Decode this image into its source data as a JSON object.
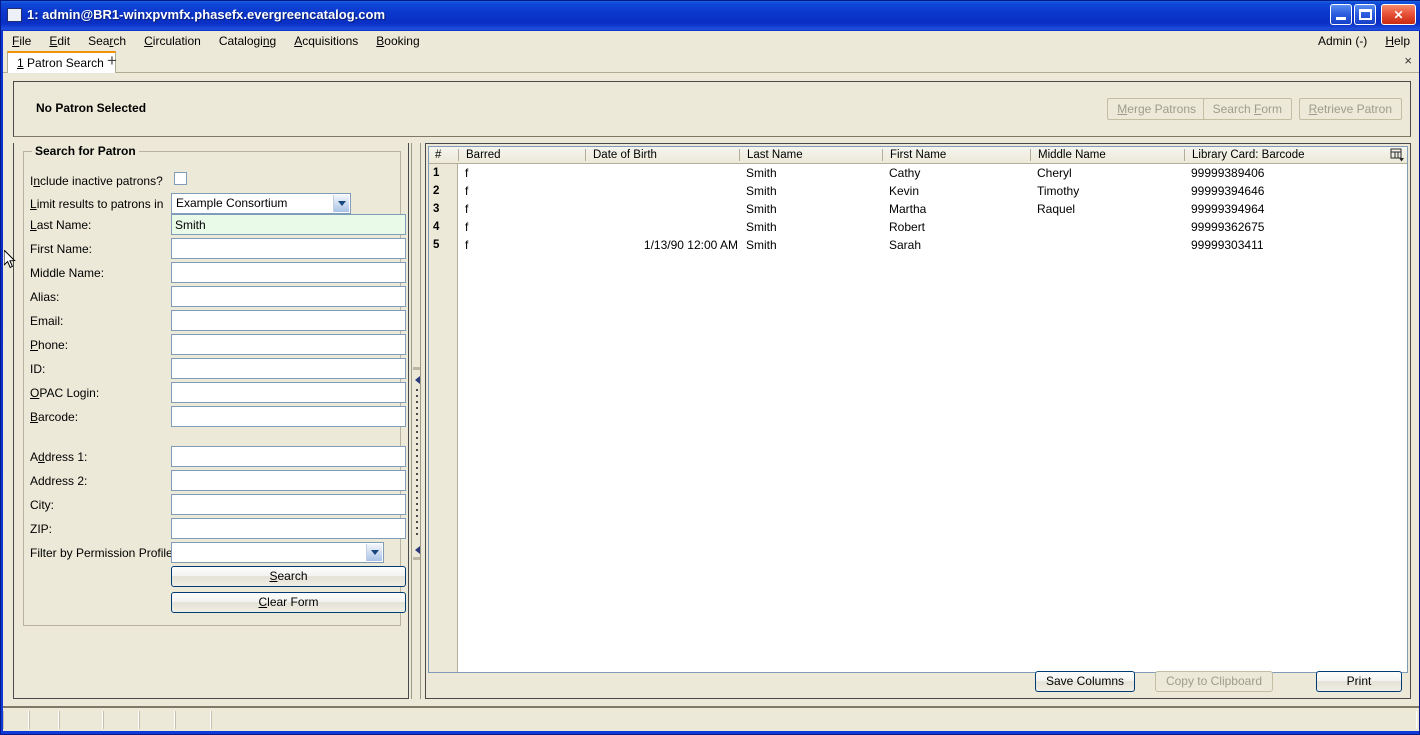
{
  "window": {
    "title": "1: admin@BR1-winxpvmfx.phasefx.evergreencatalog.com",
    "minimize_label": "Minimize",
    "maximize_label": "Maximize",
    "close_label": "✕"
  },
  "menubar": {
    "items": [
      {
        "label": "File",
        "accel_index": 0
      },
      {
        "label": "Edit",
        "accel_index": 0
      },
      {
        "label": "Search",
        "accel_index": 3
      },
      {
        "label": "Circulation",
        "accel_index": 0
      },
      {
        "label": "Cataloging",
        "accel_index": 8
      },
      {
        "label": "Acquisitions",
        "accel_index": 0
      },
      {
        "label": "Booking",
        "accel_index": 0
      }
    ],
    "right_items": [
      {
        "label": "Admin (-)",
        "accel_index": -1
      },
      {
        "label": "Help",
        "accel_index": 0
      }
    ]
  },
  "tabs": {
    "active": {
      "number": "1",
      "label": "Patron Search"
    },
    "add_label": "+",
    "close_label": "×"
  },
  "patron_band": {
    "status": "No Patron Selected",
    "buttons": [
      {
        "label": "Merge Patrons",
        "accel_index": 0,
        "disabled": true
      },
      {
        "label": "Search Form",
        "accel_index": 7,
        "disabled": true
      },
      {
        "label": "Retrieve Patron",
        "accel_index": 0,
        "disabled": true
      }
    ]
  },
  "search_form": {
    "legend": "Search for Patron",
    "fields": [
      {
        "label": "Include inactive patrons?",
        "accel_index": 1,
        "type": "checkbox",
        "value": false
      },
      {
        "label": "Limit results to patrons in",
        "accel_index": 0,
        "type": "select",
        "value": "Example Consortium"
      },
      {
        "label": "Last Name:",
        "accel_index": 0,
        "type": "text",
        "value": "Smith",
        "focused": true
      },
      {
        "label": "First Name:",
        "accel_index": -1,
        "type": "text",
        "value": ""
      },
      {
        "label": "Middle Name:",
        "accel_index": -1,
        "type": "text",
        "value": ""
      },
      {
        "label": "Alias:",
        "accel_index": -1,
        "type": "text",
        "value": ""
      },
      {
        "label": "Email:",
        "accel_index": -1,
        "type": "text",
        "value": ""
      },
      {
        "label": "Phone:",
        "accel_index": 0,
        "type": "text",
        "value": ""
      },
      {
        "label": "ID:",
        "accel_index": -1,
        "type": "text",
        "value": ""
      },
      {
        "label": "OPAC Login:",
        "accel_index": 0,
        "type": "text",
        "value": ""
      },
      {
        "label": "Barcode:",
        "accel_index": 0,
        "type": "text",
        "value": ""
      },
      {
        "label": "Address 1:",
        "accel_index": 1,
        "type": "text",
        "value": ""
      },
      {
        "label": "Address 2:",
        "accel_index": -1,
        "type": "text",
        "value": ""
      },
      {
        "label": "City:",
        "accel_index": -1,
        "type": "text",
        "value": ""
      },
      {
        "label": "ZIP:",
        "accel_index": -1,
        "type": "text",
        "value": ""
      },
      {
        "label": "Filter by Permission Profile:",
        "accel_index": -1,
        "type": "select",
        "value": ""
      }
    ],
    "buttons": [
      {
        "label": "Search",
        "accel_index": 0
      },
      {
        "label": "Clear Form",
        "accel_index": 0
      }
    ]
  },
  "results": {
    "columns": [
      {
        "key": "num",
        "label": "#"
      },
      {
        "key": "barred",
        "label": "Barred"
      },
      {
        "key": "dob",
        "label": "Date of Birth"
      },
      {
        "key": "last",
        "label": "Last Name"
      },
      {
        "key": "first",
        "label": "First Name"
      },
      {
        "key": "middle",
        "label": "Middle Name"
      },
      {
        "key": "barcode",
        "label": "Library Card: Barcode"
      }
    ],
    "rows": [
      {
        "num": "1",
        "barred": "f",
        "dob": "",
        "last": "Smith",
        "first": "Cathy",
        "middle": "Cheryl",
        "barcode": "99999389406"
      },
      {
        "num": "2",
        "barred": "f",
        "dob": "",
        "last": "Smith",
        "first": "Kevin",
        "middle": "Timothy",
        "barcode": "99999394646"
      },
      {
        "num": "3",
        "barred": "f",
        "dob": "",
        "last": "Smith",
        "first": "Martha",
        "middle": "Raquel",
        "barcode": "99999394964"
      },
      {
        "num": "4",
        "barred": "f",
        "dob": "",
        "last": "Smith",
        "first": "Robert",
        "middle": "",
        "barcode": "99999362675"
      },
      {
        "num": "5",
        "barred": "f",
        "dob": "1/13/90 12:00 AM",
        "last": "Smith",
        "first": "Sarah",
        "middle": "",
        "barcode": "99999303411"
      }
    ],
    "column_picker_name": "column-picker-icon",
    "buttons": [
      {
        "label": "Save Columns",
        "disabled": false
      },
      {
        "label": "Copy to Clipboard",
        "disabled": true
      },
      {
        "label": "Print",
        "disabled": false
      }
    ]
  },
  "statusbar": {
    "segments": [
      "",
      "",
      "",
      "",
      "",
      "",
      ""
    ]
  },
  "colors": {
    "titlebar_blue": "#0b36cc",
    "chrome_beige": "#ece9d8",
    "tab_accent_orange": "#f0920b",
    "focused_field_green": "#e9fae9",
    "field_border": "#7f9db9",
    "disabled_text": "#a09c8b"
  }
}
